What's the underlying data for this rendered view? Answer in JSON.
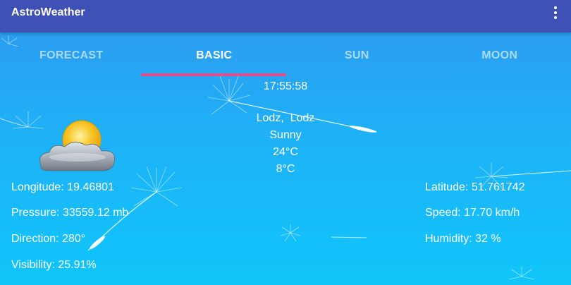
{
  "appbar": {
    "title": "AstroWeather",
    "menu_icon": "more-vert-icon"
  },
  "tabs": [
    {
      "label": "FORECAST",
      "active": false
    },
    {
      "label": "BASIC",
      "active": true
    },
    {
      "label": "SUN",
      "active": false
    },
    {
      "label": "MOON",
      "active": false
    }
  ],
  "basic": {
    "time": "17:55:58",
    "location": "Lodz,  Lodz",
    "condition": "Sunny",
    "temperature": "24°C",
    "feels_temp": "8°C",
    "icon": "partly-cloudy-icon",
    "left": {
      "longitude": "Longitude: 19.46801",
      "pressure": "Pressure: 33559.12 mb",
      "direction": "Direction: 280°",
      "visibility": "Visibility: 25.91%"
    },
    "right": {
      "latitude": "Latitude: 51.761742",
      "speed": "Speed: 17.70 km/h",
      "humidity": "Humidity: 32 %"
    }
  },
  "colors": {
    "appbar": "#3f51b5",
    "tab_indicator": "#e0508a",
    "background_top": "#2f97ee",
    "background_bottom": "#10c6fb"
  }
}
